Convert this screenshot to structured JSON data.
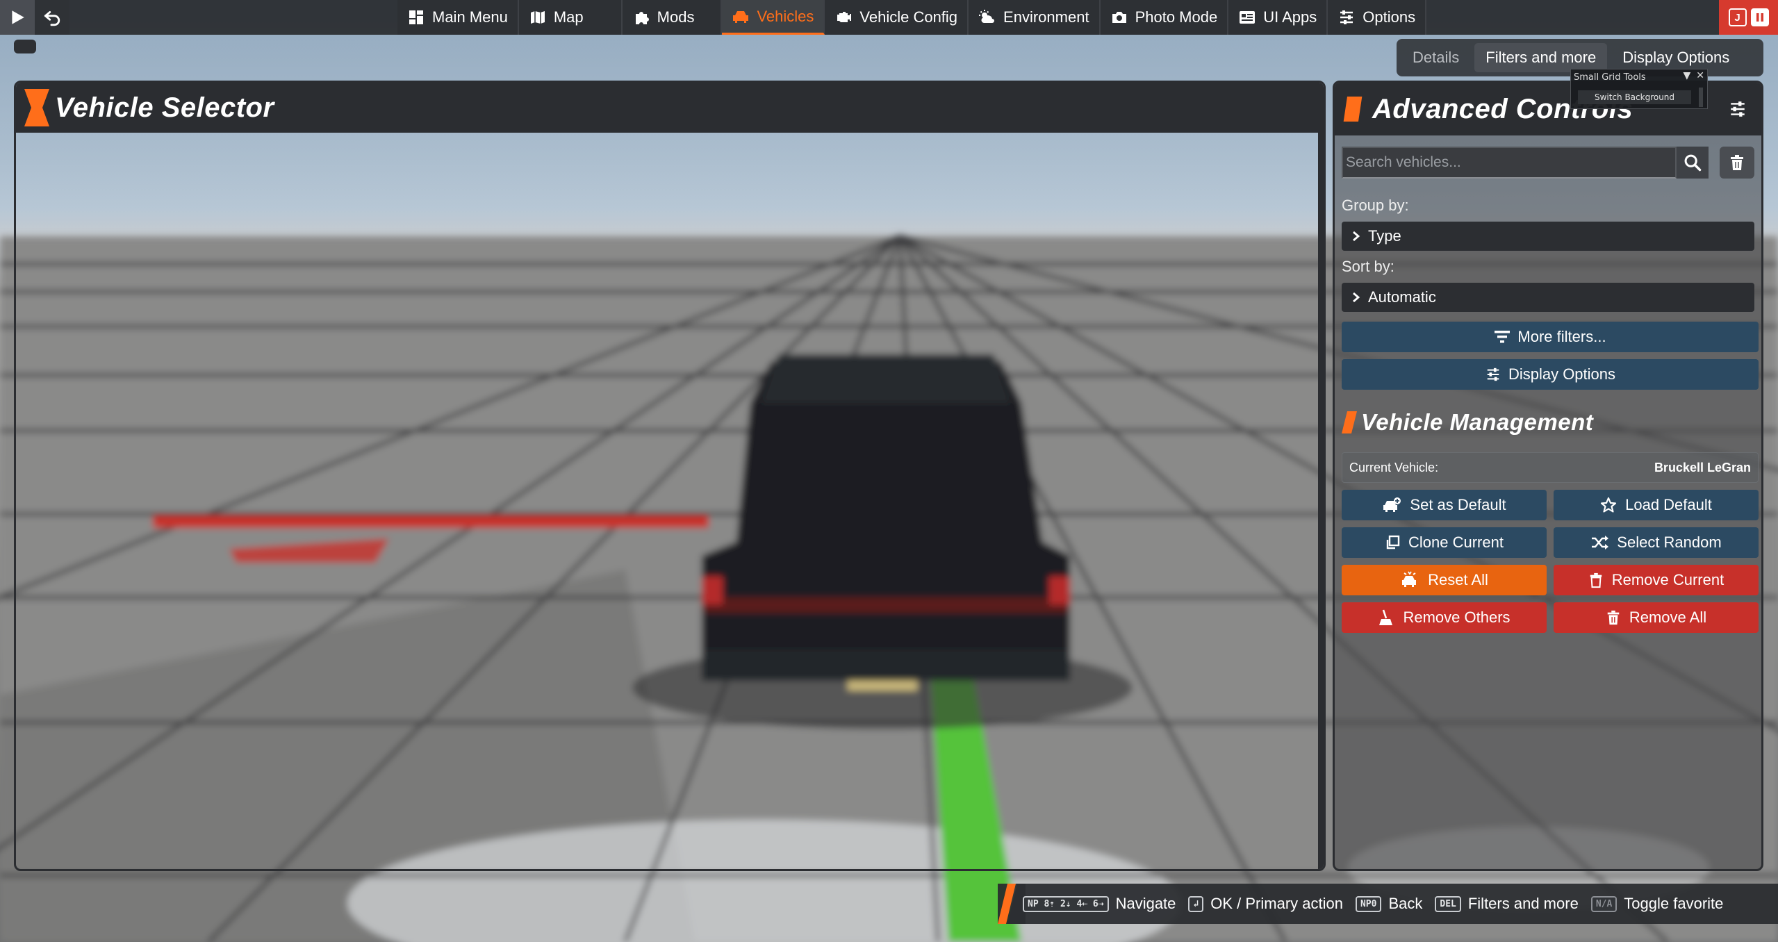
{
  "topbar": {
    "tabs": [
      {
        "label": "Main Menu",
        "icon": "dashboard-icon"
      },
      {
        "label": "Map",
        "icon": "map-icon"
      },
      {
        "label": "Mods",
        "icon": "puzzle-icon"
      },
      {
        "label": "Vehicles",
        "icon": "car-icon"
      },
      {
        "label": "Vehicle Config",
        "icon": "engine-icon"
      },
      {
        "label": "Environment",
        "icon": "weather-icon"
      },
      {
        "label": "Photo Mode",
        "icon": "camera-icon"
      },
      {
        "label": "UI Apps",
        "icon": "apps-icon"
      },
      {
        "label": "Options",
        "icon": "sliders-icon"
      }
    ],
    "active_tab": "Vehicles",
    "right_buttons": {
      "j_label": "J"
    },
    "accent_color": "#ff6e1a",
    "exit_color": "#d63a2e"
  },
  "subtabs": {
    "items": [
      "Details",
      "Filters and more",
      "Display Options"
    ],
    "active": "Filters and more"
  },
  "vehicle_selector": {
    "title": "Vehicle Selector"
  },
  "small_grid_tools": {
    "title": "Small Grid Tools",
    "button": "Switch Background"
  },
  "advanced_controls": {
    "title": "Advanced Controls",
    "search": {
      "placeholder": "Search vehicles...",
      "value": ""
    },
    "group_by": {
      "label": "Group by:",
      "value": "Type"
    },
    "sort_by": {
      "label": "Sort by:",
      "value": "Automatic"
    },
    "more_filters": "More filters...",
    "display_options": "Display Options"
  },
  "vehicle_management": {
    "title": "Vehicle Management",
    "current_label": "Current Vehicle:",
    "current_value": "Bruckell LeGran",
    "buttons": {
      "set_default": "Set as Default",
      "load_default": "Load Default",
      "clone_current": "Clone Current",
      "select_random": "Select Random",
      "reset_all": "Reset All",
      "remove_current": "Remove Current",
      "remove_others": "Remove Others",
      "remove_all": "Remove All"
    },
    "colors": {
      "blue": "#2c4a62",
      "orange": "#e86410",
      "red": "#c7302a"
    }
  },
  "hints": [
    {
      "key": "NP 8⇡ 2⇣ 4⇠ 6⇢",
      "label": "Navigate"
    },
    {
      "key": "↲",
      "label": "OK / Primary action"
    },
    {
      "key": "NP0",
      "label": "Back"
    },
    {
      "key": "DEL",
      "label": "Filters and more"
    },
    {
      "key": "N/A",
      "label": "Toggle favorite"
    }
  ]
}
